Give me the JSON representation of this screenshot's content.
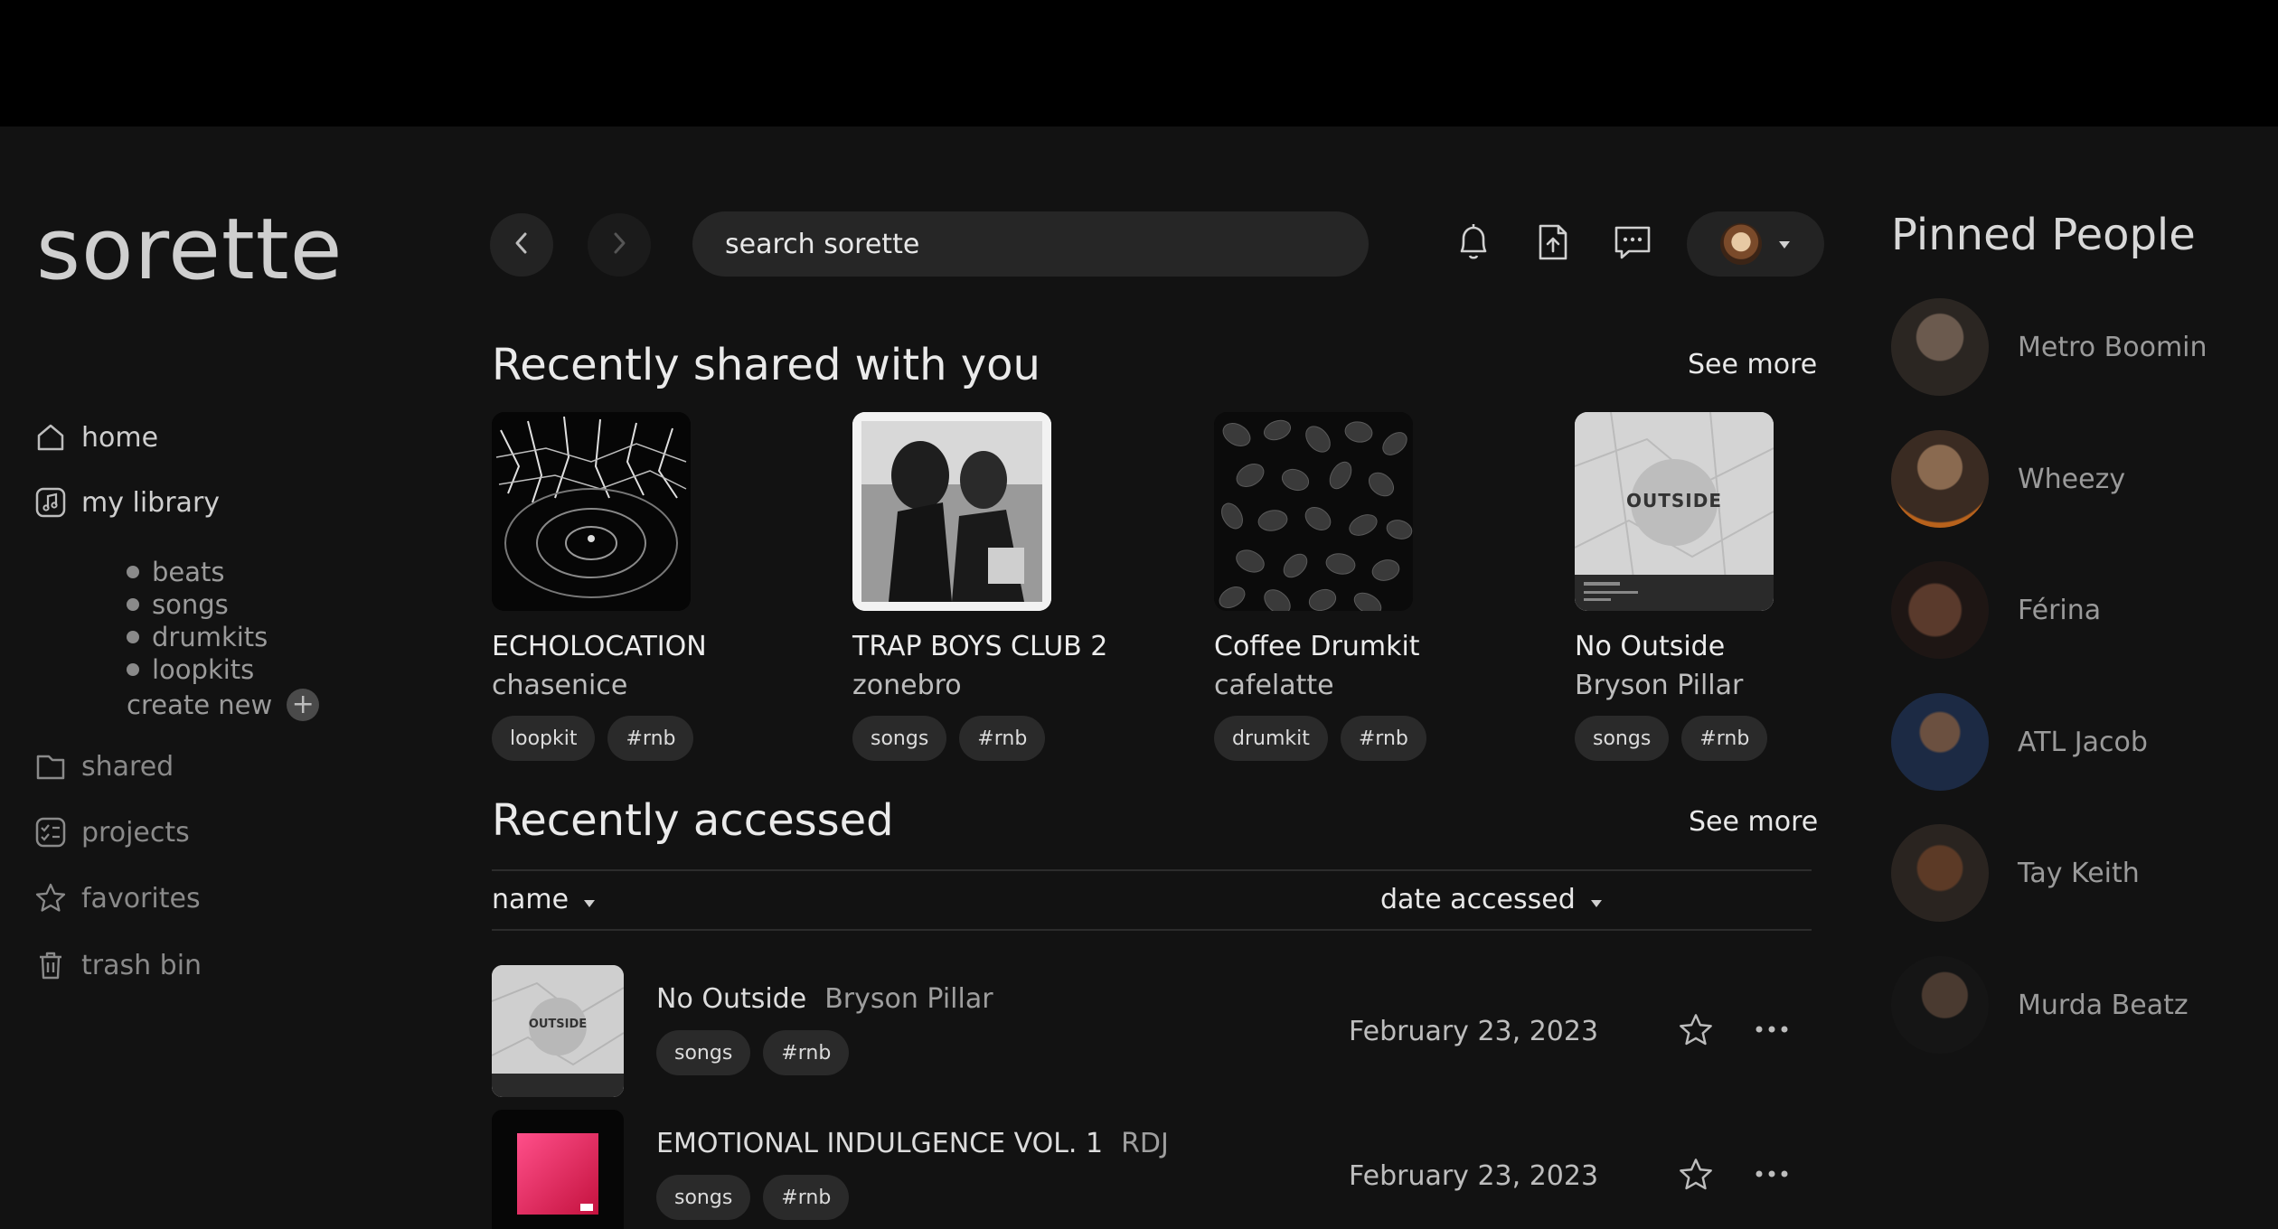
{
  "app": {
    "logo": "sorette"
  },
  "sidebar": {
    "items": [
      {
        "label": "home",
        "icon": "home-icon"
      },
      {
        "label": "my library",
        "icon": "music-note-icon"
      },
      {
        "label": "shared",
        "icon": "folder-icon"
      },
      {
        "label": "projects",
        "icon": "checklist-icon"
      },
      {
        "label": "favorites",
        "icon": "star-icon"
      },
      {
        "label": "trash bin",
        "icon": "trash-icon"
      }
    ],
    "library_subitems": [
      "beats",
      "songs",
      "drumkits",
      "loopkits"
    ],
    "create_new": "create new",
    "create_new_icon": "+"
  },
  "header": {
    "search_placeholder": "search sorette",
    "icons": [
      "back-arrow-icon",
      "forward-arrow-icon",
      "bell-icon",
      "upload-icon",
      "chat-icon",
      "profile-avatar",
      "caret-down-icon"
    ]
  },
  "recently_shared": {
    "title": "Recently shared with you",
    "see_more": "See more",
    "cards": [
      {
        "title": "ECHOLOCATION",
        "artist": "chasenice",
        "tags": [
          "loopkit",
          "#rnb"
        ]
      },
      {
        "title": "TRAP BOYS CLUB 2",
        "artist": "zonebro",
        "tags": [
          "songs",
          "#rnb"
        ]
      },
      {
        "title": "Coffee Drumkit",
        "artist": "cafelatte",
        "tags": [
          "drumkit",
          "#rnb"
        ]
      },
      {
        "title": "No Outside",
        "artist": "Bryson Pillar",
        "tags": [
          "songs",
          "#rnb"
        ],
        "cover_text": "OUTSIDE"
      }
    ]
  },
  "recently_accessed": {
    "title": "Recently accessed",
    "see_more": "See more",
    "columns": {
      "name": "name",
      "date": "date accessed"
    },
    "rows": [
      {
        "title": "No Outside",
        "artist": "Bryson Pillar",
        "tags": [
          "songs",
          "#rnb"
        ],
        "date": "February 23, 2023",
        "cover_text": "OUTSIDE"
      },
      {
        "title": "EMOTIONAL INDULGENCE VOL. 1",
        "artist": "RDJ",
        "tags": [
          "songs",
          "#rnb"
        ],
        "date": "February 23, 2023"
      }
    ]
  },
  "pinned": {
    "title": "Pinned People",
    "people": [
      "Metro Boomin",
      "Wheezy",
      "Férina",
      "ATL Jacob",
      "Tay Keith",
      "Murda Beatz"
    ]
  },
  "colors": {
    "background": "#121212",
    "surface": "#262626",
    "text": "#e6e6e6",
    "muted": "#9a9a9a"
  }
}
